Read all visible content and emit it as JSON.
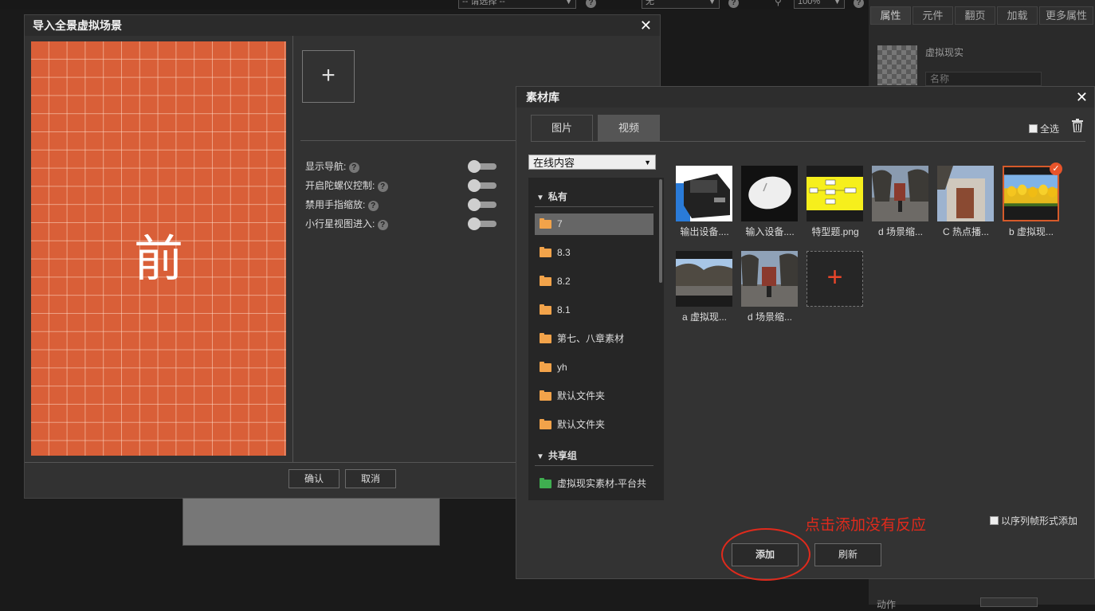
{
  "topbar": {
    "select1": "-- 请选择 --",
    "select2": "无",
    "zoom": "100%",
    "help": "?"
  },
  "right_panel": {
    "tabs": [
      "属性",
      "元件",
      "翻页",
      "加载",
      "更多属性"
    ],
    "item_title": "虚拟现实",
    "name_placeholder": "名称",
    "bottom_label": "动作"
  },
  "import_dialog": {
    "title": "导入全景虚拟场景",
    "face_label": "前",
    "add_symbol": "+",
    "options": [
      "显示导航:",
      "开启陀螺仪控制:",
      "禁用手指缩放:",
      "小行星视图进入:"
    ],
    "help": "?",
    "confirm": "确认",
    "cancel": "取消"
  },
  "library": {
    "title": "素材库",
    "tabs": [
      "图片",
      "视频"
    ],
    "select_all": "全选",
    "source_select": "在线内容",
    "tree": {
      "private_group": "私有",
      "folders": [
        "7",
        "8.3",
        "8.2",
        "8.1",
        "第七、八章素材",
        "yh",
        "默认文件夹",
        "默认文件夹"
      ],
      "shared_group": "共享组",
      "shared_folders": [
        "虚拟现实素材-平台共"
      ]
    },
    "thumbnails": [
      {
        "caption": "输出设备....",
        "kind": "printer"
      },
      {
        "caption": "输入设备....",
        "kind": "mouse"
      },
      {
        "caption": "特型题.png",
        "kind": "diagram"
      },
      {
        "caption": "d 场景缩...",
        "kind": "street"
      },
      {
        "caption": "C 热点播...",
        "kind": "gate"
      },
      {
        "caption": "b 虚拟现...",
        "kind": "tulips",
        "selected": true
      },
      {
        "caption": "a 虚拟现...",
        "kind": "trees"
      },
      {
        "caption": "d 场景缩...",
        "kind": "street2"
      }
    ],
    "add_symbol": "+",
    "sequence_add": "以序列帧形式添加",
    "add_button": "添加",
    "refresh_button": "刷新",
    "check_mark": "✓"
  },
  "annotation": "点击添加没有反应",
  "colors": {
    "accent": "#e8542a",
    "annotation": "#e02a1c",
    "preview_bg": "#d95f38",
    "folder": "#f2a34a",
    "shared_folder": "#3fae50"
  }
}
